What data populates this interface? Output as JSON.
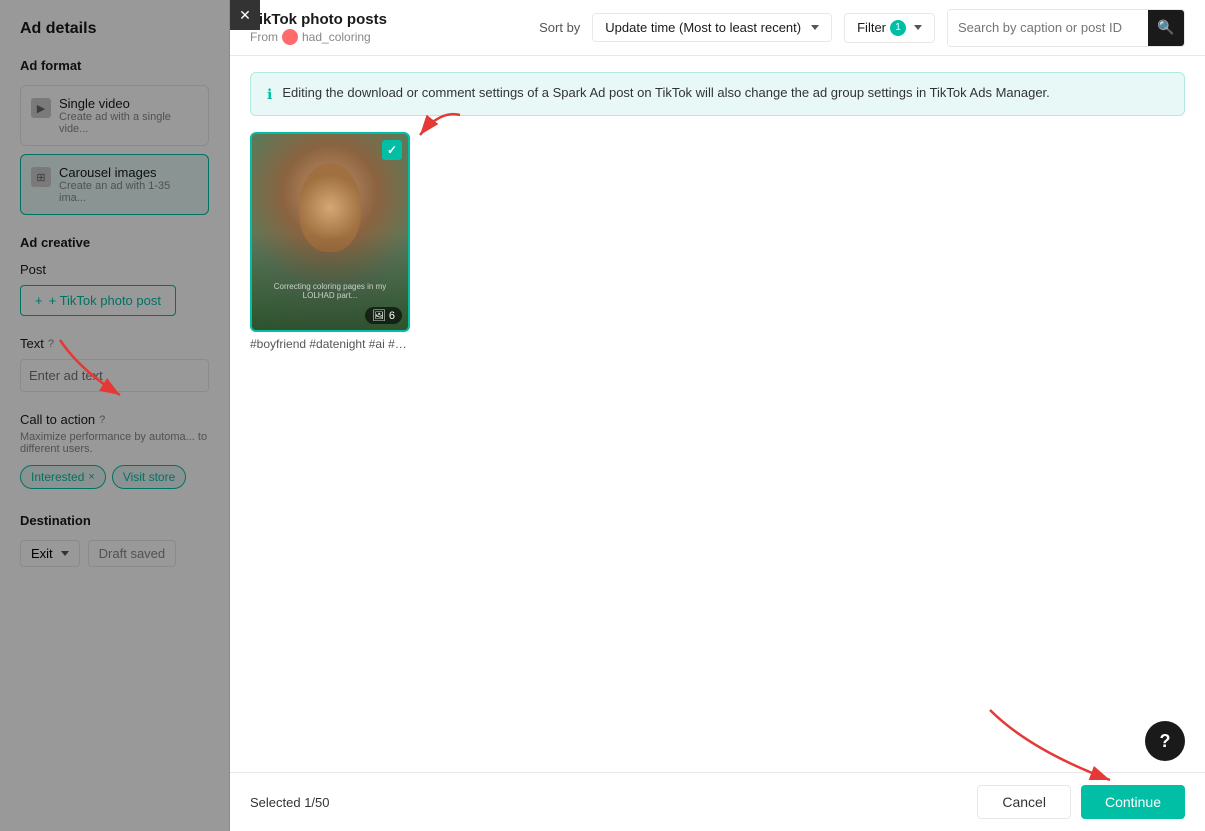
{
  "leftPanel": {
    "adDetails": "Ad details",
    "adFormat": {
      "label": "Ad format",
      "singleVideo": {
        "title": "Single video",
        "desc": "Create ad with a single vide..."
      },
      "carouselImages": {
        "title": "Carousel images",
        "desc": "Create an ad with 1-35 ima..."
      }
    },
    "adCreative": {
      "label": "Ad creative",
      "post": "Post",
      "addPostBtn": "+ TikTok photo post"
    },
    "text": {
      "label": "Text",
      "placeholder": "Enter ad text"
    },
    "callToAction": {
      "label": "Call to action",
      "desc": "Maximize performance by automa... to different users.",
      "tags": [
        "Interested",
        "Visit store"
      ]
    },
    "destination": {
      "label": "Destination",
      "exitBtn": "Exit",
      "draftBtn": "Draft saved"
    }
  },
  "modal": {
    "title": "TikTok photo posts",
    "from": "From",
    "username": "had_coloring",
    "closeBtn": "✕",
    "header": {
      "sortLabel": "Sort by",
      "sortValue": "Update time (Most to least recent)",
      "filterBtn": "Filter (1)",
      "filterCount": "1",
      "searchPlaceholder": "Search by caption or post ID"
    },
    "infoBanner": "Editing the download or comment settings of a Spark Ad post on TikTok will also change the ad group settings in TikTok Ads Manager.",
    "posts": [
      {
        "caption": "#boyfriend #datenight #ai #c...",
        "count": "6",
        "selected": true
      }
    ],
    "footer": {
      "selected": "Selected 1/50",
      "cancelBtn": "Cancel",
      "continueBtn": "Continue"
    }
  },
  "helpBtn": "?",
  "icons": {
    "search": "🔍",
    "info": "ℹ",
    "check": "✓",
    "image": "🖼",
    "chevronDown": "▾"
  }
}
